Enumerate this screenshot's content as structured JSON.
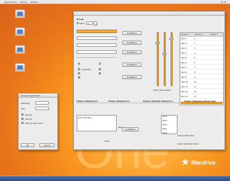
{
  "topbar": {
    "menu1": "Applications",
    "menu2": "Places",
    "menu3": "System",
    "clock": "10:25"
  },
  "desktop": {
    "icon_labels": [
      "",
      "",
      "",
      ""
    ]
  },
  "wallpaper": {
    "big_text": "One"
  },
  "brand": {
    "name": "Mandriva"
  },
  "main_window": {
    "title": "",
    "group_header": "Group",
    "radio_label": "Label",
    "spin_value": "0",
    "buttons": [
      "PushButton",
      "PushButton",
      "PushButton",
      "PushButton",
      "PushButton"
    ],
    "checkbox_label": "CheckBox",
    "table_headers": [
      "Column 1",
      "Column 2",
      "Column 3"
    ],
    "table_rows": [
      {
        "label": "Item 1",
        "value": "1"
      },
      {
        "label": "Item 2",
        "value": "2"
      },
      {
        "label": "Item 3",
        "value": "3"
      },
      {
        "label": "Item 4",
        "value": "4"
      },
      {
        "label": "Item 5",
        "value": "5"
      },
      {
        "label": "Item 6",
        "value": "6"
      },
      {
        "label": "Item 7",
        "value": "7"
      },
      {
        "label": "Item 8",
        "value": "8"
      },
      {
        "label": "Item 9",
        "value": "9"
      },
      {
        "label": "Item 10",
        "value": "10"
      },
      {
        "label": "Item 11",
        "value": "11"
      },
      {
        "label": "Item 12",
        "value": "12"
      },
      {
        "label": "Item 13",
        "value": "13"
      }
    ],
    "frame_headers": [
      "Frame (Shadow in)",
      "Frame (Shadow in)",
      "Frame (Shadow etched in)",
      "Frame (Shadow etched out)"
    ],
    "text_edit_label": "text edit label",
    "small_label_1": "label",
    "small_label_2": "label",
    "bottom_button": "PushButton",
    "status_label": "Label",
    "right_labels": [
      "label",
      "label",
      "label",
      "label",
      "label"
    ],
    "right_bottom_label": "Label Label label",
    "footer_label": "Label label label label",
    "slider_caption": "Slider Slider Slider"
  },
  "small_window": {
    "title": "Sample Application",
    "field_label_1": "Sampling",
    "field_label_2": "Item",
    "option_1": "Sample",
    "option_2": "Sample",
    "option_3": "Sample data value",
    "ok_label": "OK",
    "cancel_label": "Cancel"
  }
}
